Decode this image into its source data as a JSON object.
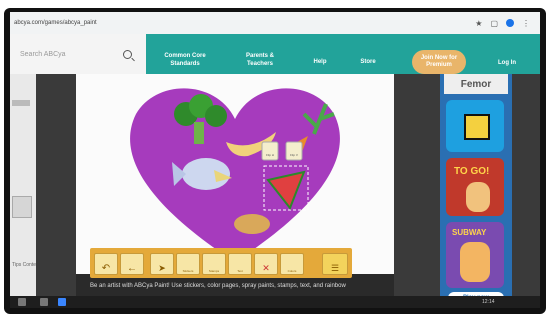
{
  "browser": {
    "url": "abcya.com/games/abcya_paint"
  },
  "header": {
    "search_placeholder": "Search ABCya",
    "nav": [
      {
        "label": "Common Core Standards"
      },
      {
        "label": "Parents & Teachers"
      },
      {
        "label": "Help"
      },
      {
        "label": "Store"
      }
    ],
    "join_label": "Join Now for Premium",
    "login_label": "Log In"
  },
  "left_panel": {
    "label": "Tips Conte"
  },
  "canvas": {
    "heart_color": "#a63bbd",
    "sticker_button_labels": [
      "Flip H",
      "Flip V"
    ]
  },
  "toolbar": {
    "tools": [
      {
        "label": "Stickers"
      },
      {
        "label": "Stamps"
      },
      {
        "label": "Text"
      },
      {
        "label": "Delete"
      },
      {
        "label": "Colors"
      }
    ]
  },
  "description": {
    "line1": "Be an artist with ABCya Paint! Use stickers, color pages, spray paints, stamps, text, and rainbow"
  },
  "ads": {
    "top_label": "Femor",
    "tiles": [
      {
        "name": "geometry-dash"
      },
      {
        "name": "to-go"
      },
      {
        "name": "subway-surfers"
      }
    ],
    "play_now": "Play now"
  },
  "taskbar": {
    "time": "12:14"
  }
}
